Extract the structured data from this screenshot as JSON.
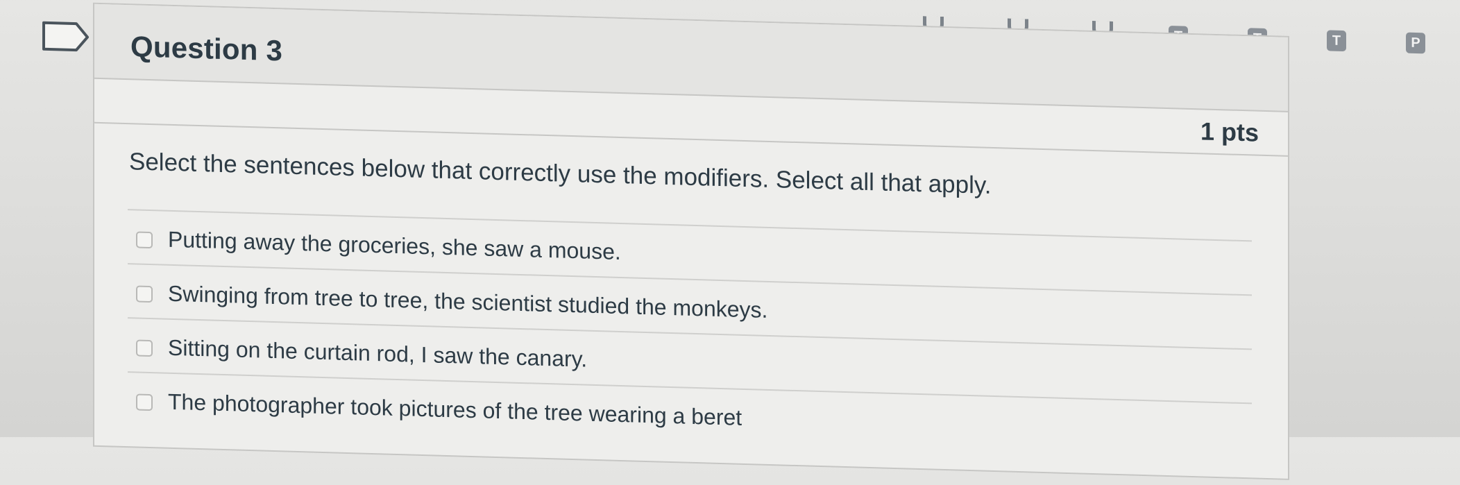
{
  "question": {
    "title": "Question 3",
    "points": "1 pts",
    "prompt": "Select the sentences below that correctly use the modifiers. Select all that apply.",
    "answers": [
      {
        "label": "Putting away the groceries, she saw a mouse.",
        "checked": false
      },
      {
        "label": "Swinging from tree to tree, the scientist studied the monkeys.",
        "checked": false
      },
      {
        "label": "Sitting on the curtain rod, I saw the canary.",
        "checked": false
      },
      {
        "label": "The photographer took pictures of the tree wearing a beret",
        "checked": false
      }
    ]
  },
  "nav": {
    "badges": [
      "T",
      "T",
      "T",
      "P"
    ]
  },
  "icons": {
    "flag": "bookmark-flag-icon",
    "checkbox": "checkbox-icon"
  },
  "colors": {
    "text": "#2d3b45",
    "badge": "#8a9097"
  }
}
